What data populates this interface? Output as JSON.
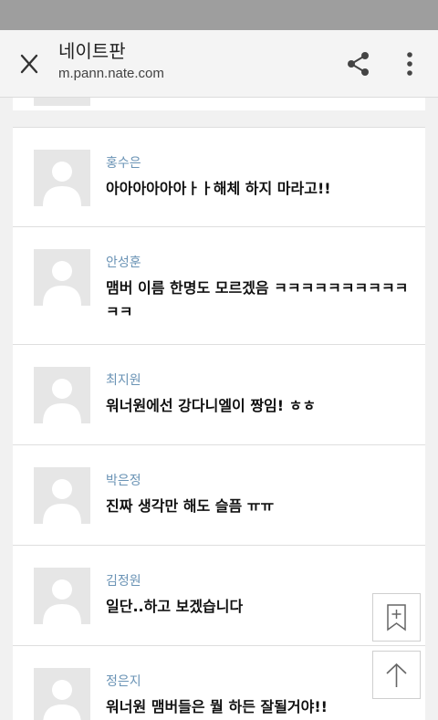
{
  "header": {
    "title": "네이트판",
    "url": "m.pann.nate.com"
  },
  "icons": {
    "close": "close-icon",
    "share": "share-icon",
    "more": "more-vert-icon",
    "bookmark": "bookmark-add-icon",
    "scroll_top": "arrow-up-icon",
    "avatar": "default-avatar-icon"
  },
  "colors": {
    "author_name": "#6a93b5",
    "page_background": "#f1f1f1",
    "status_bar": "#9e9e9e"
  },
  "comments": [
    {
      "author": "홍수은",
      "text": "아아아아아아ㅏㅏ해체 하지 마라고!!"
    },
    {
      "author": "안성훈",
      "text": "맴버 이름 한명도 모르겠음 ㅋㅋㅋㅋㅋㅋㅋㅋㅋㅋㅋㅋ"
    },
    {
      "author": "최지원",
      "text": "워너원에선 강다니엘이 짱임! ㅎㅎ"
    },
    {
      "author": "박은정",
      "text": "진짜 생각만 해도 슬픔 ㅠㅠ"
    },
    {
      "author": "김정원",
      "text": "일단..하고 보겠습니다"
    },
    {
      "author": "정은지",
      "text": "워너원 맴버들은 뭘 하든 잘될거야!!"
    }
  ]
}
